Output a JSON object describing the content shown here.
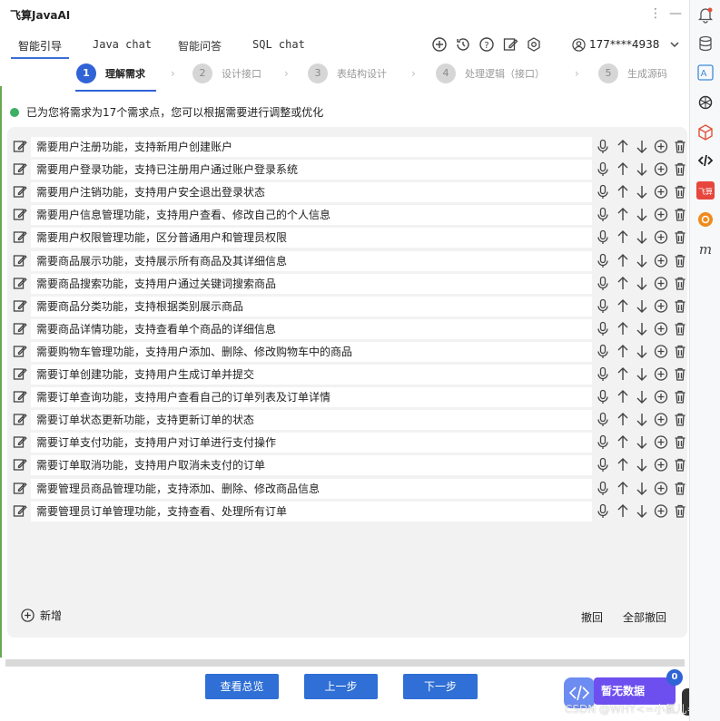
{
  "app": {
    "title": "飞算JavaAI"
  },
  "tabs": [
    {
      "label": "智能引导"
    },
    {
      "label": "Java chat"
    },
    {
      "label": "智能问答"
    },
    {
      "label": "SQL chat"
    }
  ],
  "user": {
    "phone": "177****4938"
  },
  "steps": [
    {
      "num": "1",
      "label": "理解需求"
    },
    {
      "num": "2",
      "label": "设计接口"
    },
    {
      "num": "3",
      "label": "表结构设计"
    },
    {
      "num": "4",
      "label": "处理逻辑（接口）"
    },
    {
      "num": "5",
      "label": "生成源码"
    }
  ],
  "info": {
    "text": "已为您将需求为17个需求点，您可以根据需要进行调整或优化"
  },
  "requirements": [
    "需要用户注册功能，支持新用户创建账户",
    "需要用户登录功能，支持已注册用户通过账户登录系统",
    "需要用户注销功能，支持用户安全退出登录状态",
    "需要用户信息管理功能，支持用户查看、修改自己的个人信息",
    "需要用户权限管理功能，区分普通用户和管理员权限",
    "需要商品展示功能，支持展示所有商品及其详细信息",
    "需要商品搜索功能，支持用户通过关键词搜索商品",
    "需要商品分类功能，支持根据类别展示商品",
    "需要商品详情功能，支持查看单个商品的详细信息",
    "需要购物车管理功能，支持用户添加、删除、修改购物车中的商品",
    "需要订单创建功能，支持用户生成订单并提交",
    "需要订单查询功能，支持用户查看自己的订单列表及订单详情",
    "需要订单状态更新功能，支持更新订单的状态",
    "需要订单支付功能，支持用户对订单进行支付操作",
    "需要订单取消功能，支持用户取消未支付的订单",
    "需要管理员商品管理功能，支持添加、删除、修改商品信息",
    "需要管理员订单管理功能，支持查看、处理所有订单"
  ],
  "actions": {
    "add": "新增",
    "undo": "撤回",
    "undo_all": "全部撤回"
  },
  "footer": {
    "overview": "查看总览",
    "prev": "上一步",
    "next": "下一步"
  },
  "assistant": {
    "no_data": "暂无数据",
    "count": "0"
  },
  "watermark": "CSDN @WHY<=小氯儿=",
  "colors": {
    "primary": "#2f63d6",
    "success": "#3cb064",
    "bubble": "#6d4ff0"
  },
  "sidebar_icons": [
    "notification-icon",
    "database-icon",
    "translate-icon",
    "openai-icon",
    "cube-icon",
    "code-icon",
    "feisuan-icon",
    "orange-plugin-icon",
    "m-plugin-icon"
  ]
}
